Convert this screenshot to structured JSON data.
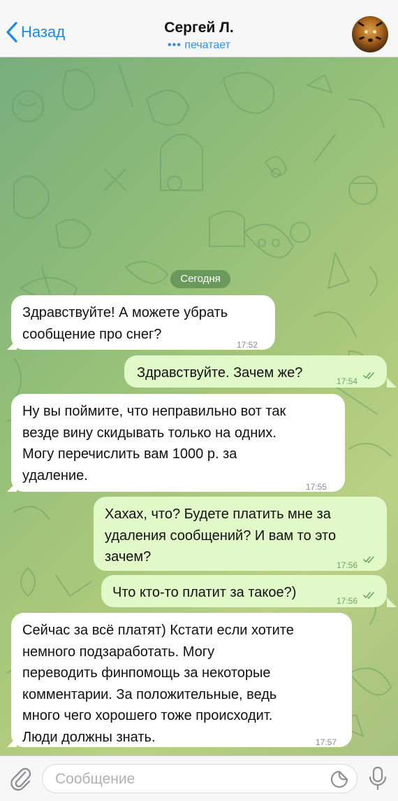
{
  "header": {
    "back_label": "Назад",
    "title": "Сергей Л.",
    "status_dots": "•••",
    "status_text": "печатает"
  },
  "chat": {
    "date_label": "Сегодня",
    "messages": [
      {
        "direction": "in",
        "lines": [
          "Здравствуйте! А можете убрать",
          "сообщение про снег?"
        ],
        "time": "17:52"
      },
      {
        "direction": "out",
        "lines": [
          "Здравствуйте. Зачем же?"
        ],
        "time": "17:54",
        "read": true
      },
      {
        "direction": "in",
        "lines": [
          "Ну вы поймите, что неправильно вот так",
          "везде вину скидывать только на одних.",
          "Могу перечислить вам 1000 р. за",
          "удаление."
        ],
        "time": "17:55"
      },
      {
        "direction": "out",
        "lines": [
          "Хахах, что? Будете платить мне за",
          "удаления сообщений? И вам то это",
          "зачем?"
        ],
        "time": "17:56",
        "read": true
      },
      {
        "direction": "out",
        "lines": [
          "Что кто-то платит за такое?)"
        ],
        "time": "17:56",
        "read": true
      },
      {
        "direction": "in",
        "lines": [
          "Сейчас за всё платят) Кстати если хотите",
          "немного подзаработать. Могу",
          "переводить финпомощь за некоторые",
          "комментарии. За положительные, ведь",
          "много чего хорошего тоже происходит.",
          "Люди должны знать."
        ],
        "time": "17:57"
      }
    ]
  },
  "input": {
    "placeholder": "Сообщение"
  },
  "colors": {
    "accent": "#1e88e5",
    "incoming_bubble": "#ffffff",
    "outgoing_bubble": "#e1f8c8",
    "check_color": "#6aa85d"
  },
  "icons": [
    "chevron-left-icon",
    "paperclip-icon",
    "sticker-icon",
    "microphone-icon",
    "double-check-icon"
  ]
}
